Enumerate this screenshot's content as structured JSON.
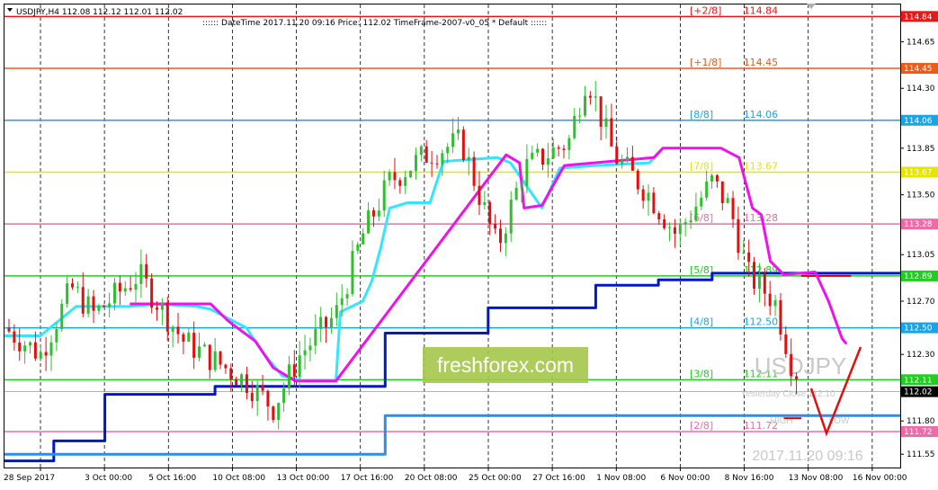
{
  "chart_header": {
    "symbol_line": "USDJPY,H4  112.08 112.12 112.01 112.02",
    "info_line": ":::::: DateTime  2017.11.20 09:16    Price: 112.02    TimeFrame-2007-v0_05    *   Default   ::::::"
  },
  "watermark": {
    "brand": "freshforex.com",
    "symbol": "USDJPY",
    "timestamp": "2017.11.20 09:16"
  },
  "overlay_labels": {
    "yesterday_close": "Yesterday Close 112.10",
    "high": "HIGH",
    "low": "LOW"
  },
  "colors": {
    "bull": "#2fbf2f",
    "bear": "#e01010",
    "cyan": "#33e5ff",
    "magenta": "#ee11ee",
    "blue": "#0018c8",
    "lightblue": "#2b8fe8",
    "red_line": "#cc0000"
  },
  "chart_data": {
    "type": "candlestick",
    "symbol": "USDJPY",
    "timeframe": "H4",
    "ylim": [
      111.45,
      114.93
    ],
    "y_ticks": [
      "114.84",
      "114.65",
      "114.45",
      "114.30",
      "114.06",
      "113.85",
      "113.67",
      "113.50",
      "113.28",
      "113.05",
      "112.89",
      "112.70",
      "112.50",
      "112.30",
      "112.11",
      "112.02",
      "111.80",
      "111.72",
      "111.55"
    ],
    "x_ticks": [
      "28 Sep 2017",
      "3 Oct 00:00",
      "5 Oct 16:00",
      "10 Oct 08:00",
      "13 Oct 00:00",
      "17 Oct 16:00",
      "20 Oct 08:00",
      "25 Oct 00:00",
      "27 Oct 16:00",
      "1 Nov 08:00",
      "6 Nov 00:00",
      "8 Nov 16:00",
      "13 Nov 08:00",
      "16 Nov 00:00"
    ],
    "murrey_levels": [
      {
        "label": "[+2/8]",
        "value": 114.84,
        "text": "114.84",
        "color": "#e81818"
      },
      {
        "label": "[+1/8]",
        "value": 114.45,
        "text": "114.45",
        "color": "#ee5a1a"
      },
      {
        "label": "[8/8]",
        "value": 114.06,
        "text": "114.06",
        "color": "#1aa3e6"
      },
      {
        "label": "[7/8]",
        "value": 113.67,
        "text": "113.67",
        "color": "#e6e600"
      },
      {
        "label": "[6/8]",
        "value": 113.28,
        "text": "113.28",
        "color": "#f06aa8"
      },
      {
        "label": "[5/8]",
        "value": 112.89,
        "text": "112.89",
        "color": "#22cc22"
      },
      {
        "label": "[4/8]",
        "value": 112.5,
        "text": "112.50",
        "color": "#1aa3e6"
      },
      {
        "label": "[3/8]",
        "value": 112.11,
        "text": "112.11",
        "color": "#22cc22"
      },
      {
        "label": "[2/8]",
        "value": 111.72,
        "text": "111.72",
        "color": "#f06aa8"
      }
    ],
    "last_price": 112.02,
    "short_lines": [
      {
        "value": 112.89,
        "x_from": 0.945,
        "x_to": 1.0,
        "color": "#cc0000"
      },
      {
        "value": 111.82,
        "x_from": 0.87,
        "x_to": 1.0,
        "color": "#cc0000"
      }
    ],
    "series": [
      {
        "name": "",
        "style": "step",
        "color": "#0018c8",
        "points": [
          [
            0,
            111.5
          ],
          [
            0.055,
            111.5
          ],
          [
            0.055,
            111.65
          ],
          [
            0.112,
            111.65
          ],
          [
            0.112,
            112.0
          ],
          [
            0.235,
            112.0
          ],
          [
            0.235,
            112.06
          ],
          [
            0.425,
            112.06
          ],
          [
            0.425,
            112.46
          ],
          [
            0.54,
            112.46
          ],
          [
            0.54,
            112.65
          ],
          [
            0.66,
            112.65
          ],
          [
            0.66,
            112.82
          ],
          [
            0.73,
            112.82
          ],
          [
            0.73,
            112.86
          ],
          [
            0.79,
            112.86
          ],
          [
            0.79,
            112.91
          ],
          [
            1.0,
            112.91
          ]
        ]
      },
      {
        "name": "",
        "style": "step",
        "color": "#2b8fe8",
        "points": [
          [
            0,
            111.55
          ],
          [
            0.425,
            111.55
          ],
          [
            0.425,
            111.84
          ],
          [
            1.0,
            111.84
          ]
        ]
      },
      {
        "name": "",
        "style": "line",
        "color": "#33e5ff",
        "points": [
          [
            0.0,
            112.44
          ],
          [
            0.04,
            112.44
          ],
          [
            0.08,
            112.66
          ],
          [
            0.14,
            112.66
          ],
          [
            0.17,
            112.68
          ],
          [
            0.215,
            112.66
          ],
          [
            0.23,
            112.64
          ],
          [
            0.27,
            112.5
          ],
          [
            0.29,
            112.3
          ],
          [
            0.31,
            112.14
          ],
          [
            0.335,
            112.1
          ],
          [
            0.37,
            112.1
          ],
          [
            0.375,
            112.62
          ],
          [
            0.4,
            112.7
          ],
          [
            0.41,
            112.85
          ],
          [
            0.42,
            113.1
          ],
          [
            0.43,
            113.4
          ],
          [
            0.45,
            113.44
          ],
          [
            0.475,
            113.44
          ],
          [
            0.49,
            113.75
          ],
          [
            0.55,
            113.78
          ],
          [
            0.565,
            113.74
          ],
          [
            0.6,
            113.4
          ],
          [
            0.62,
            113.7
          ],
          [
            0.66,
            113.72
          ],
          [
            0.72,
            113.74
          ],
          [
            0.735,
            113.85
          ]
        ]
      },
      {
        "name": "",
        "style": "line",
        "color": "#ee11ee",
        "points": [
          [
            0.14,
            112.68
          ],
          [
            0.23,
            112.68
          ],
          [
            0.25,
            112.55
          ],
          [
            0.28,
            112.4
          ],
          [
            0.3,
            112.2
          ],
          [
            0.325,
            112.1
          ],
          [
            0.37,
            112.1
          ],
          [
            0.56,
            113.8
          ],
          [
            0.575,
            113.74
          ],
          [
            0.58,
            113.4
          ],
          [
            0.6,
            113.42
          ],
          [
            0.625,
            113.72
          ],
          [
            0.725,
            113.78
          ],
          [
            0.735,
            113.85
          ],
          [
            0.8,
            113.85
          ],
          [
            0.82,
            113.78
          ],
          [
            0.835,
            113.4
          ],
          [
            0.845,
            113.35
          ],
          [
            0.855,
            113.0
          ],
          [
            0.87,
            112.9
          ],
          [
            0.905,
            112.92
          ],
          [
            0.92,
            112.7
          ],
          [
            0.935,
            112.42
          ],
          [
            0.94,
            112.38
          ]
        ]
      }
    ],
    "candles_ohlc": []
  }
}
